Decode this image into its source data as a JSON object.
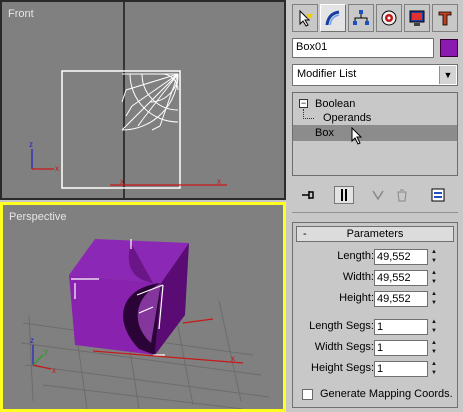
{
  "viewports": {
    "front": {
      "label": "Front"
    },
    "perspective": {
      "label": "Perspective"
    }
  },
  "tabs": [
    {
      "icon": "create-cursor-icon"
    },
    {
      "icon": "modify-icon"
    },
    {
      "icon": "hierarchy-icon"
    },
    {
      "icon": "motion-icon"
    },
    {
      "icon": "display-icon"
    },
    {
      "icon": "utilities-icon"
    }
  ],
  "object": {
    "name": "Box01",
    "color": "#8a1ab0"
  },
  "modifier_list": {
    "label": "Modifier List"
  },
  "stack": {
    "boolean": "Boolean",
    "operands": "Operands",
    "box": "Box"
  },
  "parameters": {
    "title": "Parameters",
    "length_label": "Length:",
    "length": "49,552",
    "width_label": "Width:",
    "width": "49,552",
    "height_label": "Height:",
    "height": "49,552",
    "length_segs_label": "Length Segs:",
    "length_segs": "1",
    "width_segs_label": "Width Segs:",
    "width_segs": "1",
    "height_segs_label": "Height Segs:",
    "height_segs": "1",
    "gen_mapping_label": "Generate Mapping Coords.",
    "gen_mapping_checked": false
  },
  "axis_labels": {
    "x": "x",
    "y": "y",
    "z": "z"
  }
}
